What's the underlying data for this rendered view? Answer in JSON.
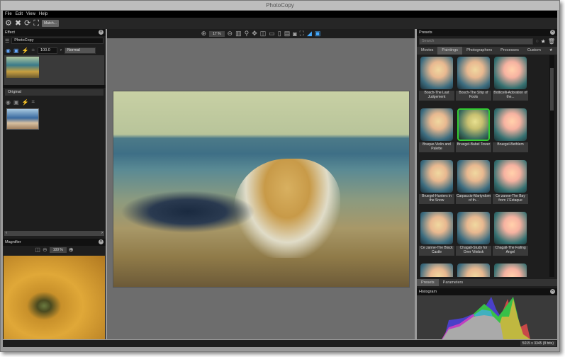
{
  "window": {
    "title": "PhotoCopy"
  },
  "menu": [
    "File",
    "Edit",
    "View",
    "Help"
  ],
  "toolbar": {
    "match_label": "Match..."
  },
  "effect_panel": {
    "title": "Effect",
    "preset_name": "PhotoCopy",
    "opacity": "100.0",
    "blend_mode": "Normal"
  },
  "original_panel": {
    "title": "Original"
  },
  "magnifier": {
    "title": "Magnifier",
    "zoom": "100 %"
  },
  "canvas": {
    "zoom": "17 %"
  },
  "presets": {
    "title": "Presets",
    "search_placeholder": "Search",
    "tabs": [
      "Movies",
      "Paintings",
      "Photographers",
      "Processes",
      "Custom"
    ],
    "active_tab": "Paintings",
    "items": [
      "Bosch-The Last Judgement",
      "Bosch-The Ship of Fools",
      "Botticelli-Adoration of the...",
      "Braque-Violin and Palette",
      "Bruegel-Babel Tower",
      "Bruegel-Bethlem",
      "Bruegel-Hunters in the Snow",
      "Carpaccio-Martyrdom of th...",
      "Ce zanne-The Bay from L'Estaque",
      "Ce zanne-The Black Castle",
      "Chagall-Study for Over Vitebsk",
      "Chagall-The Falling Angel",
      "",
      "",
      ""
    ],
    "selected": "Bruegel-Babel Tower",
    "bottom_tabs": [
      "Presets",
      "Parameters"
    ]
  },
  "histogram": {
    "title": "Histogram"
  },
  "status": {
    "image_info": "5015 x 3345 (8 bits)"
  }
}
